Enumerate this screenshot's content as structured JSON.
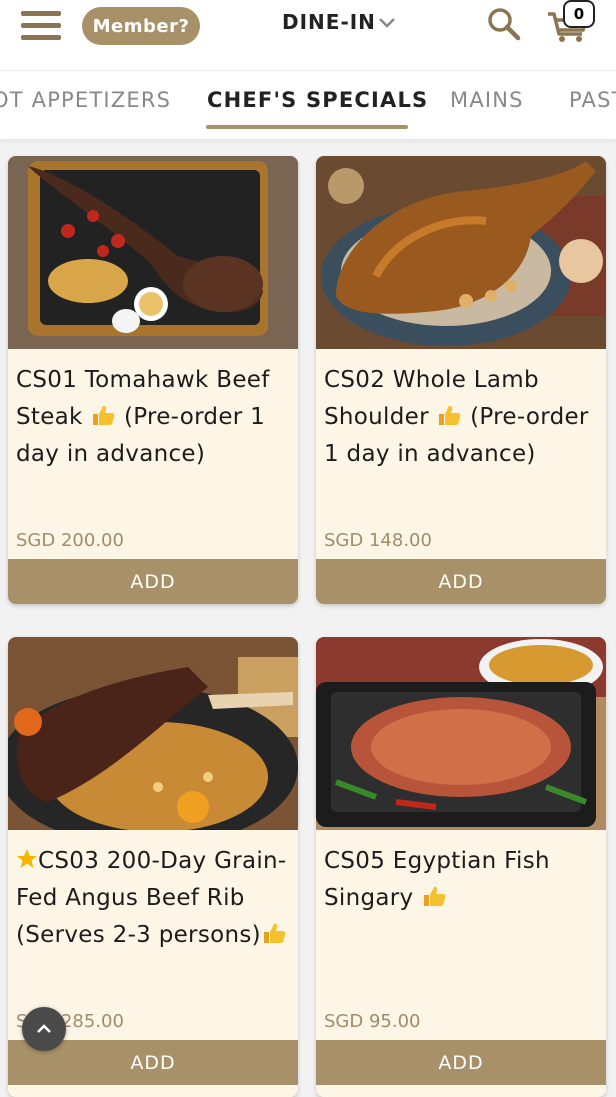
{
  "header": {
    "member_label": "Member?",
    "mode_label": "DINE-IN",
    "cart_count": "0"
  },
  "categories": [
    {
      "label": "OT APPETIZERS"
    },
    {
      "label": "CHEF'S SPECIALS",
      "active": true
    },
    {
      "label": "MAINS"
    },
    {
      "label": "PAST"
    }
  ],
  "items": [
    {
      "title_pre": "CS01 Tomahawk Beef Steak",
      "title_post": "(Pre-order 1 day in advance)",
      "price": "SGD 200.00",
      "add_label": "ADD",
      "image": "tomahawk-steak-photo"
    },
    {
      "title_pre": "CS02 Whole Lamb Shoulder",
      "title_post": "(Pre-order 1 day in advance)",
      "price": "SGD 148.00",
      "add_label": "ADD",
      "image": "lamb-shoulder-photo"
    },
    {
      "title_pre": "CS03 200-Day Grain-Fed Angus Beef Rib (Serves 2-3 persons)",
      "title_post": "",
      "price": "SGD 285.00",
      "add_label": "ADD",
      "image": "beef-rib-photo"
    },
    {
      "title_pre": "CS05 Egyptian Fish Singary",
      "title_post": "",
      "price": "SGD 95.00",
      "add_label": "ADD",
      "image": "fish-singary-photo"
    }
  ],
  "colors": {
    "accent": "#a89168",
    "card_bg": "#fdf6e7",
    "price": "#a08c6a"
  }
}
